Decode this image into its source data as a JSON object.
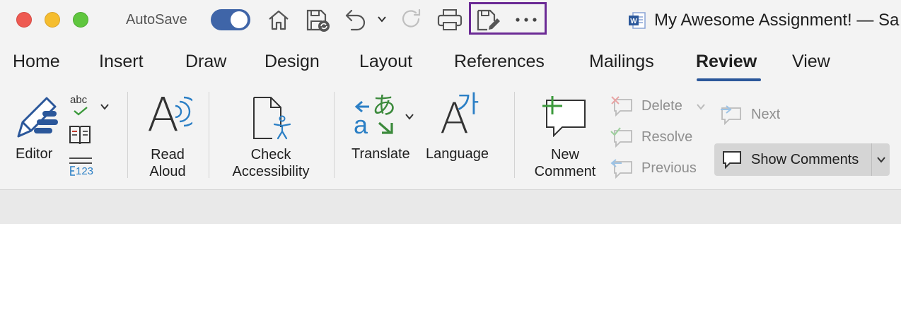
{
  "window": {
    "autosave_label": "AutoSave",
    "autosave_on": true,
    "doc_title": "My Awesome Assignment! — Sa"
  },
  "tabs": [
    {
      "label": "Home"
    },
    {
      "label": "Insert"
    },
    {
      "label": "Draw"
    },
    {
      "label": "Design"
    },
    {
      "label": "Layout"
    },
    {
      "label": "References"
    },
    {
      "label": "Mailings"
    },
    {
      "label": "Review",
      "active": true
    },
    {
      "label": "View"
    }
  ],
  "ribbon": {
    "editor": "Editor",
    "read_aloud": [
      "Read",
      "Aloud"
    ],
    "check_accessibility": [
      "Check",
      "Accessibility"
    ],
    "translate": "Translate",
    "language": "Language",
    "new_comment": [
      "New",
      "Comment"
    ],
    "delete": "Delete",
    "resolve": "Resolve",
    "previous": "Previous",
    "next": "Next",
    "show_comments": "Show Comments",
    "spelling_abc": "abc",
    "word_count_123": "123",
    "translate_glyph": "あ",
    "translate_a": "a",
    "language_glyph": "가",
    "read_aloud_a": "A",
    "language_a": "A"
  },
  "colors": {
    "accent_blue": "#2b579a",
    "toggle_blue": "#3f65a8",
    "highlight_box": "#6b2a95",
    "close_red": "#ee5a52",
    "minimize_yellow": "#f5bd2f",
    "zoom_green": "#5fc63e",
    "disabled_text": "#8f8f8f"
  }
}
